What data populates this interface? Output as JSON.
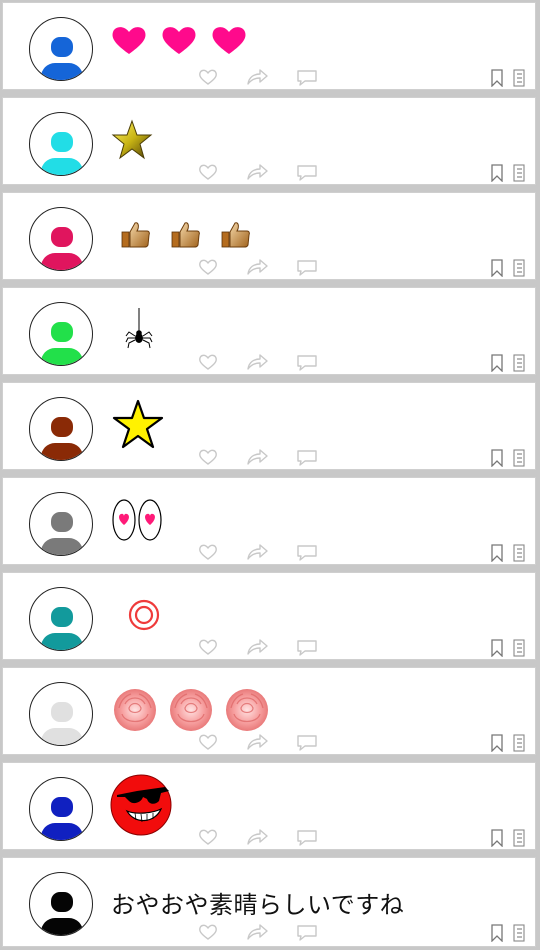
{
  "posts": [
    {
      "avatar_color": "#1565d8",
      "content_type": "icons",
      "icon": "heart-icon",
      "count": 3
    },
    {
      "avatar_color": "#22dde6",
      "content_type": "icons",
      "icon": "gold-star-icon",
      "count": 1
    },
    {
      "avatar_color": "#e0155e",
      "content_type": "icons",
      "icon": "thumbs-up-icon",
      "count": 3
    },
    {
      "avatar_color": "#22e04a",
      "content_type": "icons",
      "icon": "spider-icon",
      "count": 1
    },
    {
      "avatar_color": "#8a2a06",
      "content_type": "icons",
      "icon": "yellow-star-icon",
      "count": 1
    },
    {
      "avatar_color": "#7a7a7a",
      "content_type": "icons",
      "icon": "heart-eyes-icon",
      "count": 1
    },
    {
      "avatar_color": "#129a9c",
      "content_type": "icons",
      "icon": "double-circle-icon",
      "count": 1
    },
    {
      "avatar_color": "#e0e0e0",
      "content_type": "icons",
      "icon": "pink-rose-icon",
      "count": 3
    },
    {
      "avatar_color": "#1020c0",
      "content_type": "icons",
      "icon": "sunglasses-face-icon",
      "count": 1
    },
    {
      "avatar_color": "#050505",
      "content_type": "text",
      "text": "おやおや素晴らしいですね"
    }
  ],
  "action_icons": [
    "like-heart-icon",
    "share-arrow-icon",
    "comment-bubble-icon"
  ],
  "side_icons": [
    "bookmark-icon",
    "menu-icon"
  ]
}
